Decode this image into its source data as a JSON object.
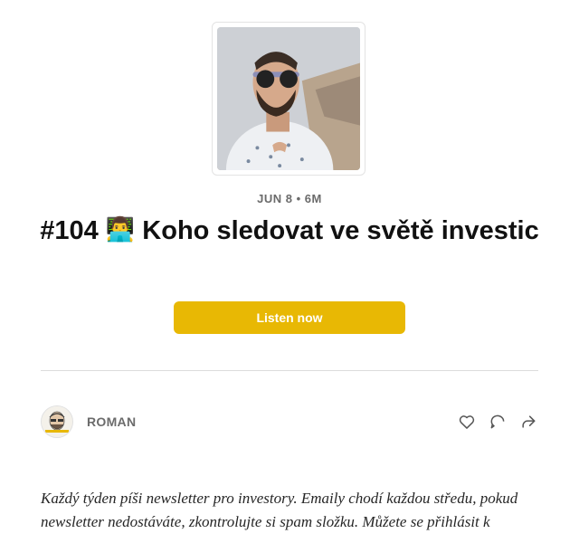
{
  "post": {
    "meta": "JUN 8 • 6M",
    "title_prefix": "#104",
    "title_emoji": "👨‍💻",
    "title_rest": "Koho sledovat ve světě investic",
    "listen_label": "Listen now"
  },
  "author": {
    "name": "ROMAN"
  },
  "actions": {
    "like_icon": "heart-icon",
    "comment_icon": "comment-icon",
    "share_icon": "share-icon"
  },
  "body": {
    "intro": "Každý týden píši newsletter pro investory. Emaily chodí každou středu, pokud newsletter nedostáváte, zkontrolujte si spam složku. Můžete se přihlásit k"
  },
  "colors": {
    "accent": "#e8b804",
    "meta_text": "#6b6b6b",
    "divider": "#dcdcdc"
  }
}
